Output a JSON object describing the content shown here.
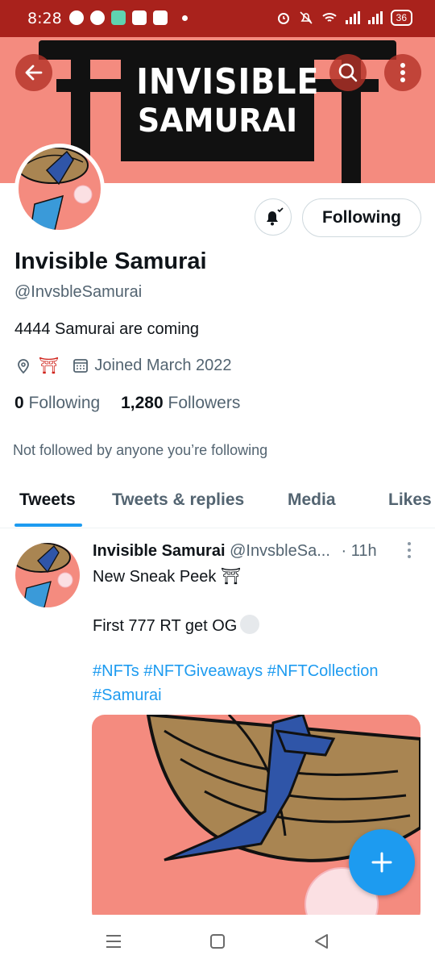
{
  "status_bar": {
    "time": "8:28",
    "battery": "36"
  },
  "banner": {
    "title_line1": "INVISIBLE",
    "title_line2": "SAMURAI"
  },
  "profile": {
    "name": "Invisible Samurai",
    "handle": "@InvsbleSamurai",
    "bio": "4444 Samurai are coming",
    "location_emoji": "⛩",
    "joined": "Joined March 2022",
    "following_count": "0",
    "following_label": "Following",
    "followers_count": "1,280",
    "followers_label": "Followers",
    "not_followed_text": "Not followed by anyone you’re following",
    "follow_button_label": "Following"
  },
  "tabs": [
    {
      "label": "Tweets"
    },
    {
      "label": "Tweets & replies"
    },
    {
      "label": "Media"
    },
    {
      "label": "Likes"
    }
  ],
  "tweet": {
    "author": "Invisible Samurai",
    "handle_truncated": "@InvsbleSa...",
    "separator": "·",
    "time": "11h",
    "line1": "New Sneak Peek ⛩",
    "line2": "First 777 RT get OG",
    "hashtags_line1": "#NFTs #NFTGiveaways #NFTCollection",
    "hashtags_line2": "#Samurai"
  },
  "colors": {
    "accent": "#1d9bf0",
    "status_bar": "#a9221c",
    "banner": "#f48b7f"
  },
  "icons": [
    "back-arrow-icon",
    "search-icon",
    "more-vertical-icon",
    "bell-icon",
    "location-icon",
    "calendar-icon",
    "plus-icon",
    "menu-icon",
    "home-square-icon",
    "back-triangle-icon"
  ]
}
